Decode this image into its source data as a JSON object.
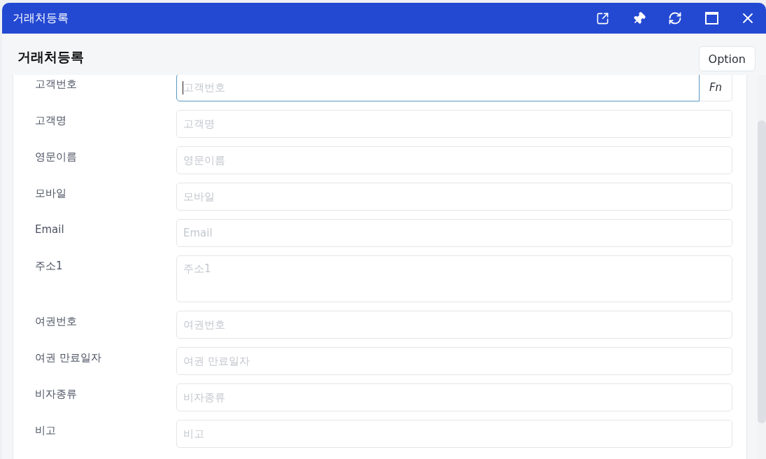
{
  "window": {
    "title": "거래처등록"
  },
  "header": {
    "title": "거래처등록",
    "option_button": "Option"
  },
  "form": {
    "fields": [
      {
        "kind": "input",
        "label": "고객번호",
        "placeholder": "고객번호",
        "focused": true,
        "action": "Fn"
      },
      {
        "kind": "input",
        "label": "고객명",
        "placeholder": "고객명",
        "focused": false
      },
      {
        "kind": "input",
        "label": "영문이름",
        "placeholder": "영문이름",
        "focused": false
      },
      {
        "kind": "input",
        "label": "모바일",
        "placeholder": "모바일",
        "focused": false
      },
      {
        "kind": "input",
        "label": "Email",
        "placeholder": "Email",
        "focused": false
      },
      {
        "kind": "textarea",
        "label": "주소1",
        "placeholder": "주소1",
        "focused": false
      },
      {
        "kind": "input",
        "label": "여권번호",
        "placeholder": "여권번호",
        "focused": false
      },
      {
        "kind": "input",
        "label": "여권 만료일자",
        "placeholder": "여권 만료일자",
        "focused": false
      },
      {
        "kind": "input",
        "label": "비자종류",
        "placeholder": "비자종류",
        "focused": false
      },
      {
        "kind": "input",
        "label": "비고",
        "placeholder": "비고",
        "focused": false
      }
    ]
  }
}
